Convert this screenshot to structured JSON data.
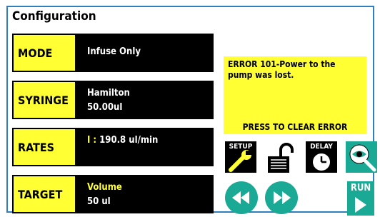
{
  "window": {
    "title": "Configuration"
  },
  "rows": [
    {
      "label": "MODE",
      "line1": "Infuse Only",
      "line2": ""
    },
    {
      "label": "SYRINGE",
      "line1": "Hamilton",
      "line2": "50.00ul"
    },
    {
      "label": "RATES",
      "line1_prefix": "I : ",
      "line1": "190.8 ul/min",
      "line2": ""
    },
    {
      "label": "TARGET",
      "line1": "Volume",
      "line2": "50 ul"
    }
  ],
  "error": {
    "message": "ERROR 101-Power to the pump was lost.",
    "action": "PRESS TO CLEAR ERROR"
  },
  "buttons": {
    "setup": "SETUP",
    "delay": "DELAY",
    "run": "RUN"
  },
  "colors": {
    "accent_yellow": "#ffff33",
    "teal": "#1aa994",
    "frame_blue": "#2f7fbf"
  },
  "icons": {
    "setup": "wrench-icon",
    "lock": "unlock-icon",
    "delay": "clock-icon",
    "view": "eye-magnifier-icon",
    "rewind": "rewind-icon",
    "fast_forward": "fast-forward-icon",
    "run": "play-icon"
  }
}
